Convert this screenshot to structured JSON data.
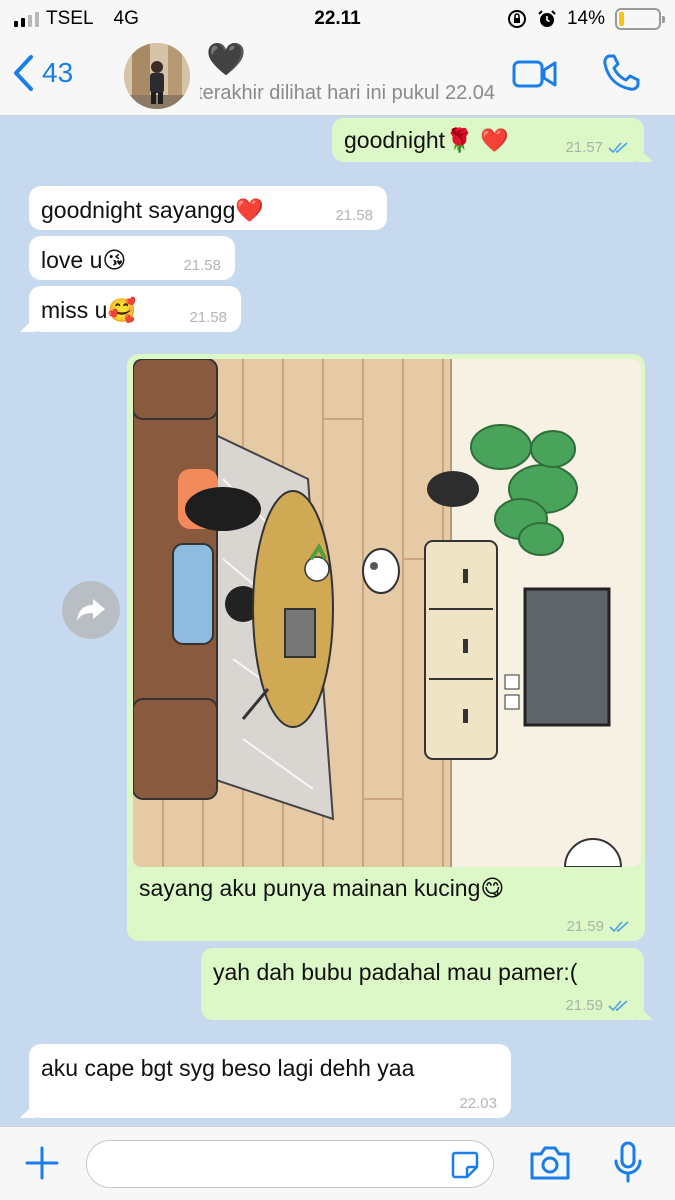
{
  "status_bar": {
    "carrier": "TSEL",
    "network": "4G",
    "time": "22.11",
    "battery_percent": "14%",
    "battery_level": 0.14
  },
  "header": {
    "back_count": "43",
    "contact_name": "🖤",
    "contact_status": "terakhir dilihat hari ini pukul 22.04"
  },
  "messages": [
    {
      "direction": "out",
      "text": "goodnight🌹 ❤️",
      "time": "21.57",
      "read": true
    },
    {
      "direction": "in",
      "text": "goodnight sayangg❤️",
      "time": "21.58"
    },
    {
      "direction": "in",
      "text": "love u😘",
      "time": "21.58"
    },
    {
      "direction": "in",
      "text": "miss u🥰",
      "time": "21.58"
    },
    {
      "direction": "out",
      "type": "image",
      "caption": "sayang aku punya mainan kucing😋",
      "time": "21.59",
      "read": true
    },
    {
      "direction": "out",
      "text": "yah dah bubu padahal mau pamer:(",
      "time": "21.59",
      "read": true
    },
    {
      "direction": "in",
      "text": "aku cape bgt syg beso lagi dehh yaa",
      "time": "22.03"
    }
  ],
  "input": {
    "placeholder": ""
  },
  "colors": {
    "accent": "#1a7ee8",
    "outgoing_bubble": "#dcf8c6",
    "incoming_bubble": "#ffffff",
    "chat_background": "#c7d9ee",
    "read_ticks": "#4fa3e3"
  }
}
